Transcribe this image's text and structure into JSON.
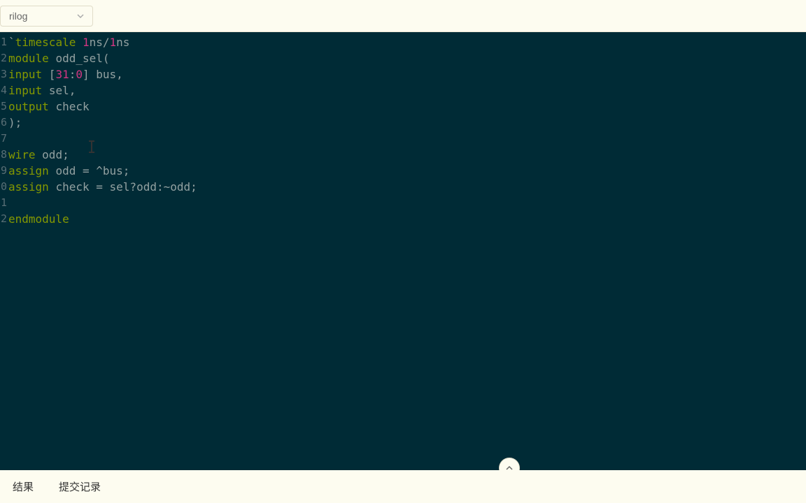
{
  "languageSelector": {
    "selected": "rilog"
  },
  "code": {
    "lines": [
      {
        "num": "1",
        "tokens": [
          {
            "cls": "plain",
            "t": "`"
          },
          {
            "cls": "kw-directive",
            "t": "timescale"
          },
          {
            "cls": "plain",
            "t": " "
          },
          {
            "cls": "num",
            "t": "1"
          },
          {
            "cls": "ns",
            "t": "ns"
          },
          {
            "cls": "plain",
            "t": "/"
          },
          {
            "cls": "num",
            "t": "1"
          },
          {
            "cls": "ns",
            "t": "ns"
          }
        ]
      },
      {
        "num": "2",
        "tokens": [
          {
            "cls": "kw-module",
            "t": "module"
          },
          {
            "cls": "plain",
            "t": " "
          },
          {
            "cls": "ident",
            "t": "odd_sel"
          },
          {
            "cls": "plain",
            "t": "("
          }
        ]
      },
      {
        "num": "3",
        "tokens": [
          {
            "cls": "kw-input",
            "t": "input"
          },
          {
            "cls": "plain",
            "t": " ["
          },
          {
            "cls": "range-num",
            "t": "31"
          },
          {
            "cls": "plain",
            "t": ":"
          },
          {
            "cls": "range-num",
            "t": "0"
          },
          {
            "cls": "plain",
            "t": "] "
          },
          {
            "cls": "ident",
            "t": "bus"
          },
          {
            "cls": "plain",
            "t": ","
          }
        ]
      },
      {
        "num": "4",
        "tokens": [
          {
            "cls": "kw-input",
            "t": "input"
          },
          {
            "cls": "plain",
            "t": " "
          },
          {
            "cls": "ident",
            "t": "sel"
          },
          {
            "cls": "plain",
            "t": ","
          }
        ]
      },
      {
        "num": "5",
        "tokens": [
          {
            "cls": "kw-output",
            "t": "output"
          },
          {
            "cls": "plain",
            "t": " "
          },
          {
            "cls": "ident",
            "t": "check"
          }
        ]
      },
      {
        "num": "6",
        "tokens": [
          {
            "cls": "plain",
            "t": ");"
          }
        ]
      },
      {
        "num": "7",
        "tokens": []
      },
      {
        "num": "8",
        "tokens": [
          {
            "cls": "kw-wire",
            "t": "wire"
          },
          {
            "cls": "plain",
            "t": " "
          },
          {
            "cls": "ident",
            "t": "odd"
          },
          {
            "cls": "plain",
            "t": ";"
          }
        ]
      },
      {
        "num": "9",
        "tokens": [
          {
            "cls": "kw-assign",
            "t": "assign"
          },
          {
            "cls": "plain",
            "t": " "
          },
          {
            "cls": "ident",
            "t": "odd"
          },
          {
            "cls": "plain",
            "t": " = ^"
          },
          {
            "cls": "ident",
            "t": "bus"
          },
          {
            "cls": "plain",
            "t": ";"
          }
        ]
      },
      {
        "num": "0",
        "tokens": [
          {
            "cls": "kw-assign",
            "t": "assign"
          },
          {
            "cls": "plain",
            "t": " "
          },
          {
            "cls": "ident",
            "t": "check"
          },
          {
            "cls": "plain",
            "t": " = "
          },
          {
            "cls": "ident",
            "t": "sel"
          },
          {
            "cls": "plain",
            "t": "?"
          },
          {
            "cls": "ident",
            "t": "odd"
          },
          {
            "cls": "plain",
            "t": ":~"
          },
          {
            "cls": "ident",
            "t": "odd"
          },
          {
            "cls": "plain",
            "t": ";"
          }
        ]
      },
      {
        "num": "1",
        "tokens": []
      },
      {
        "num": "2",
        "tokens": [
          {
            "cls": "kw-endmodule",
            "t": "endmodule"
          }
        ]
      }
    ]
  },
  "bottomTabs": {
    "results": "结果",
    "history": "提交记录"
  }
}
